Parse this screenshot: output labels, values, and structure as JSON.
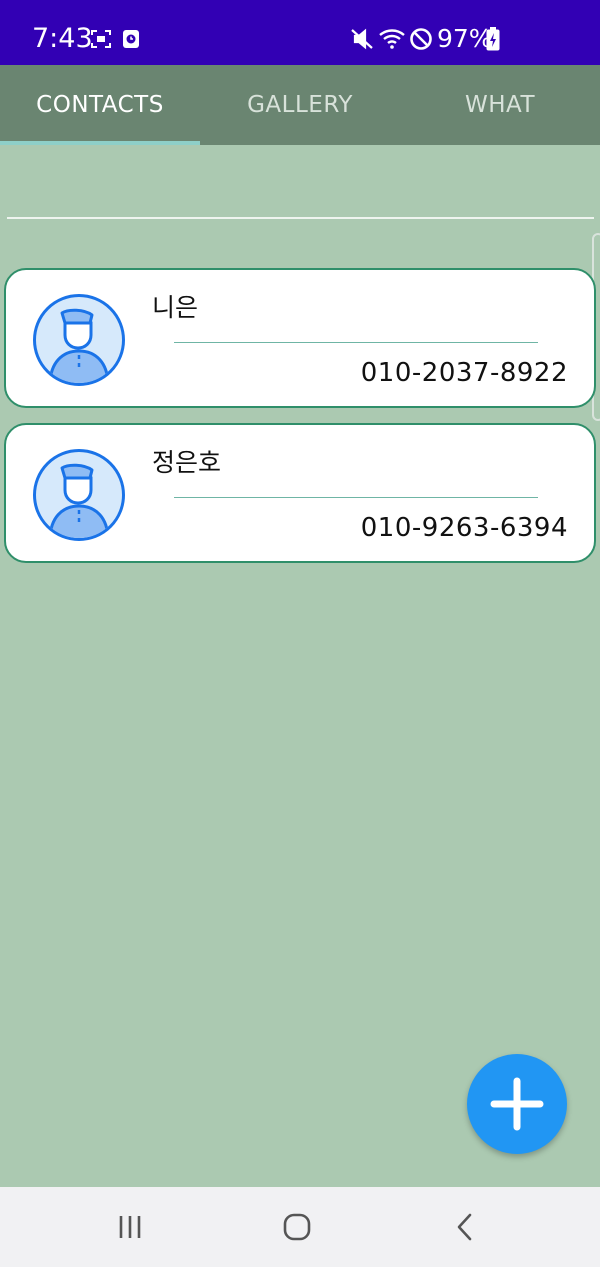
{
  "status_bar": {
    "time": "7:43",
    "battery_percent": "97%",
    "icons": [
      "screenshot-icon",
      "recorder-icon",
      "mute-icon",
      "wifi-icon",
      "do-not-disturb-icon",
      "battery-charging-icon"
    ]
  },
  "tabs": [
    {
      "label": "CONTACTS",
      "active": true
    },
    {
      "label": "GALLERY",
      "active": false
    },
    {
      "label": "WHAT",
      "active": false
    }
  ],
  "contacts": [
    {
      "name": "니은",
      "phone": "010-2037-8922"
    },
    {
      "name": "정은호",
      "phone": "010-9263-6394"
    }
  ],
  "fab": {
    "icon": "plus-icon",
    "color": "#2196f3"
  },
  "nav_bar": {
    "icons": [
      "recent-apps-icon",
      "home-icon",
      "back-icon"
    ]
  },
  "colors": {
    "status_bar": "#3200b4",
    "tab_bar": "#6a8571",
    "background": "#abc9b1",
    "card_border": "#2f8f6a"
  }
}
